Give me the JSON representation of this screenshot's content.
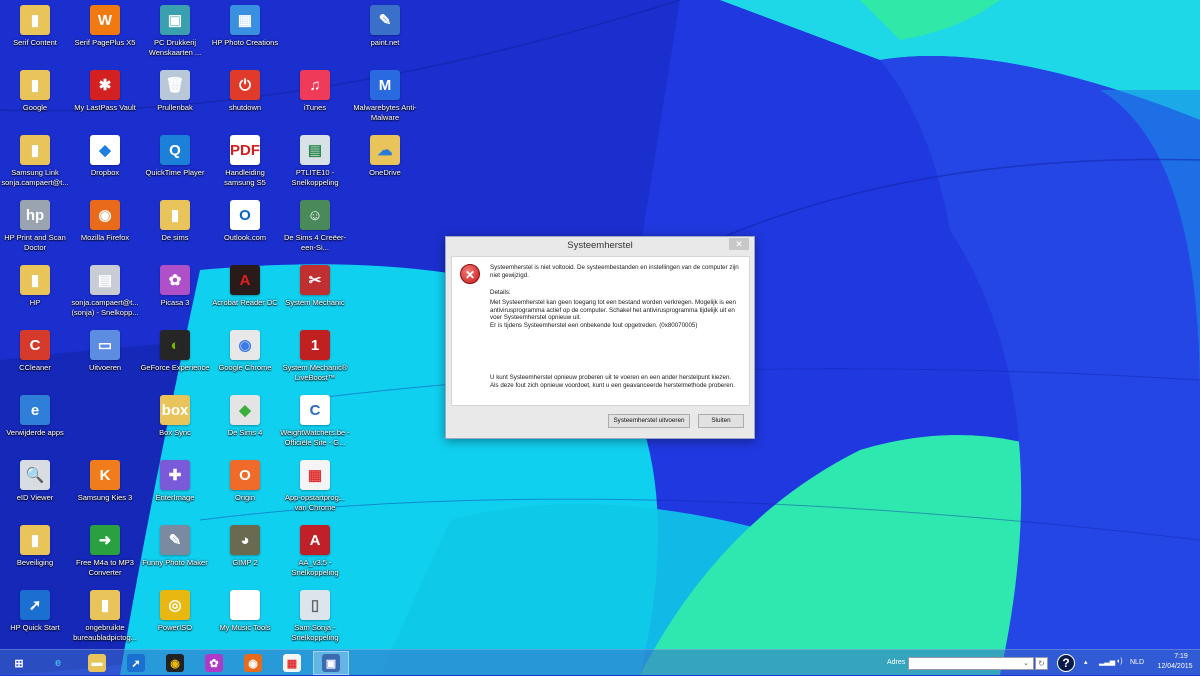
{
  "desktop": {
    "columns": [
      [
        {
          "label": "Serif Content",
          "color": "#e8c45a",
          "glyph": "▮"
        },
        {
          "label": "Google",
          "color": "#e8c45a",
          "glyph": "▮"
        },
        {
          "label": "Samsung Link sonja.campaert@t...",
          "color": "#e8c45a",
          "glyph": "▮"
        },
        {
          "label": "HP Print and Scan Doctor",
          "color": "#9aa4b0",
          "glyph": "hp"
        },
        {
          "label": "HP",
          "color": "#e8c45a",
          "glyph": "▮"
        },
        {
          "label": "CCleaner",
          "color": "#d53a2a",
          "glyph": "C"
        },
        {
          "label": "Verwijderde apps",
          "color": "#2f7fd8",
          "glyph": "e"
        },
        {
          "label": "eID Viewer",
          "color": "#d8dde4",
          "glyph": "🔍"
        },
        {
          "label": "Beveiliging",
          "color": "#e8c45a",
          "glyph": "▮"
        },
        {
          "label": "HP Quick Start",
          "color": "#1a6fd0",
          "glyph": "➚"
        }
      ],
      [
        {
          "label": "Serif PagePlus X5",
          "color": "#f07a10",
          "glyph": "W"
        },
        {
          "label": "My LastPass Vault",
          "color": "#d32020",
          "glyph": "✱"
        },
        {
          "label": "Dropbox",
          "color": "#ffffff",
          "glyph": "◆",
          "fg": "#1e7fe0"
        },
        {
          "label": "Mozilla Firefox",
          "color": "#e86a1a",
          "glyph": "◉"
        },
        {
          "label": "sonja.campaert@t... (sonja) - Snelkopp...",
          "color": "#c8ccd4",
          "glyph": "▤"
        },
        {
          "label": "Uitvoeren",
          "color": "#5c8de0",
          "glyph": "▭"
        },
        null,
        {
          "label": "Samsung Kies 3",
          "color": "#f07c1c",
          "glyph": "K"
        },
        {
          "label": "Free M4a to MP3 Converter",
          "color": "#2aa040",
          "glyph": "➜"
        },
        {
          "label": "ongebruikte bureaubladpictog...",
          "color": "#e8c45a",
          "glyph": "▮"
        }
      ],
      [
        {
          "label": "PC Drukkerij Wenskaarten ...",
          "color": "#3aa0b0",
          "glyph": "▣"
        },
        {
          "label": "Prullenbak",
          "color": "#b8c8d8",
          "glyph": "🗑"
        },
        {
          "label": "QuickTime Player",
          "color": "#1c7fd8",
          "glyph": "Q"
        },
        {
          "label": "De sims",
          "color": "#e8c45a",
          "glyph": "▮"
        },
        {
          "label": "Picasa 3",
          "color": "#b050c8",
          "glyph": "✿"
        },
        {
          "label": "GeForce Experience",
          "color": "#262626",
          "glyph": "◐",
          "fg": "#76b900"
        },
        {
          "label": "Box Sync",
          "color": "#e8c45a",
          "glyph": "box"
        },
        {
          "label": "EnterImage",
          "color": "#7a5ad8",
          "glyph": "✚"
        },
        {
          "label": "Funny Photo Maker",
          "color": "#7a8aa0",
          "glyph": "✎"
        },
        {
          "label": "PowerISO",
          "color": "#e8b810",
          "glyph": "◎"
        }
      ],
      [
        {
          "label": "HP Photo Creations",
          "color": "#3a90e0",
          "glyph": "▦"
        },
        {
          "label": "shutdown",
          "color": "#e03a2a",
          "glyph": "⏻"
        },
        {
          "label": "Handleiding samsung S5",
          "color": "#ffffff",
          "glyph": "PDF",
          "fg": "#d02020"
        },
        {
          "label": "Outlook.com",
          "color": "#ffffff",
          "glyph": "O",
          "fg": "#0a64c8"
        },
        {
          "label": "Acrobat Reader DC",
          "color": "#2a1a1a",
          "glyph": "A",
          "fg": "#e02020"
        },
        {
          "label": "Google Chrome",
          "color": "#e8e8e8",
          "glyph": "◉",
          "fg": "#3a7ae8"
        },
        {
          "label": "De Sims 4",
          "color": "#e4e4e4",
          "glyph": "◆",
          "fg": "#3ab03a"
        },
        {
          "label": "Origin",
          "color": "#f06a2a",
          "glyph": "O"
        },
        {
          "label": "GIMP 2",
          "color": "#6a6a50",
          "glyph": "◕"
        },
        {
          "label": "My Music Tools",
          "color": "#ffffff",
          "glyph": ""
        }
      ],
      [
        null,
        {
          "label": "iTunes",
          "color": "#f03a5a",
          "glyph": "♫"
        },
        {
          "label": "PTLITE10 - Snelkoppeling",
          "color": "#d8e0e8",
          "glyph": "▤",
          "fg": "#2a8a4a"
        },
        {
          "label": "De Sims 4 Creëer-een-Si...",
          "color": "#4a8a5a",
          "glyph": "☺"
        },
        {
          "label": "System Mechanic",
          "color": "#c03030",
          "glyph": "✂"
        },
        {
          "label": "System Mechanic® LiveBoost™",
          "color": "#c02020",
          "glyph": "1"
        },
        {
          "label": "WeightWatchers.be - Officiële Site - G...",
          "color": "#ffffff",
          "glyph": "C",
          "fg": "#2a6ac0"
        },
        {
          "label": "App-opstartprog... van Chrome",
          "color": "#f4f4f4",
          "glyph": "▦",
          "fg": "#e03030"
        },
        {
          "label": "AA_v3.5 - Snelkoppeling",
          "color": "#c02028",
          "glyph": "A"
        },
        {
          "label": "Sam Sonja - Snelkoppeling",
          "color": "#dce4ec",
          "glyph": "▯",
          "fg": "#666"
        }
      ],
      [
        {
          "label": "paint.net",
          "color": "#3a70c8",
          "glyph": "✎"
        },
        {
          "label": "Malwarebytes Anti-Malware",
          "color": "#2a6ae0",
          "glyph": "M"
        },
        {
          "label": "OneDrive",
          "color": "#e8c45a",
          "glyph": "☁",
          "fg": "#2a7ad8"
        }
      ]
    ]
  },
  "dialog": {
    "title": "Systeemherstel",
    "close": "✕",
    "message": "Systeemherstel is niet voltooid. De systeembestanden en instellingen van de computer zijn niet gewijzigd.",
    "details_label": "Details:",
    "details": "Met Systeemherstel kan geen toegang tot een bestand worden verkregen. Mogelijk is een antivirusprogramma actief op de computer. Schakel het antivirusprogramma tijdelijk uit en voer Systeemherstel opnieuw uit.",
    "error": "Er is tijdens Systeemherstel een onbekende fout opgetreden. (0x80070005)",
    "hint": "U kunt Systeemherstel opnieuw proberen uit te voeren en een ander herstelpunt kiezen. Als deze fout zich opnieuw voordoet, kunt u een geavanceerde herstelmethode proberen.",
    "run_button": "Systeemherstel uitvoeren",
    "close_button": "Sluiten"
  },
  "taskbar": {
    "items": [
      {
        "name": "start",
        "color": "transparent",
        "glyph": "⊞"
      },
      {
        "name": "internet-explorer",
        "color": "transparent",
        "glyph": "e",
        "fg": "#4ab0f0"
      },
      {
        "name": "file-explorer",
        "color": "#e8c45a",
        "glyph": "▬"
      },
      {
        "name": "hp-quick-start",
        "color": "#1a6fd0",
        "glyph": "➚"
      },
      {
        "name": "media-app",
        "color": "#222",
        "glyph": "◉",
        "fg": "#e8b810"
      },
      {
        "name": "photo-app",
        "color": "#b03ac8",
        "glyph": "✿"
      },
      {
        "name": "firefox",
        "color": "#e86a1a",
        "glyph": "◉"
      },
      {
        "name": "app-launcher",
        "color": "#f4f4f4",
        "glyph": "▦",
        "fg": "#e03030"
      },
      {
        "name": "system-restore",
        "color": "#3a6ab0",
        "glyph": "▣"
      }
    ],
    "address_label": "Adres",
    "address_value": "",
    "help": "?",
    "language": "NLD",
    "time": "7:19",
    "date": "12/04/2015"
  }
}
